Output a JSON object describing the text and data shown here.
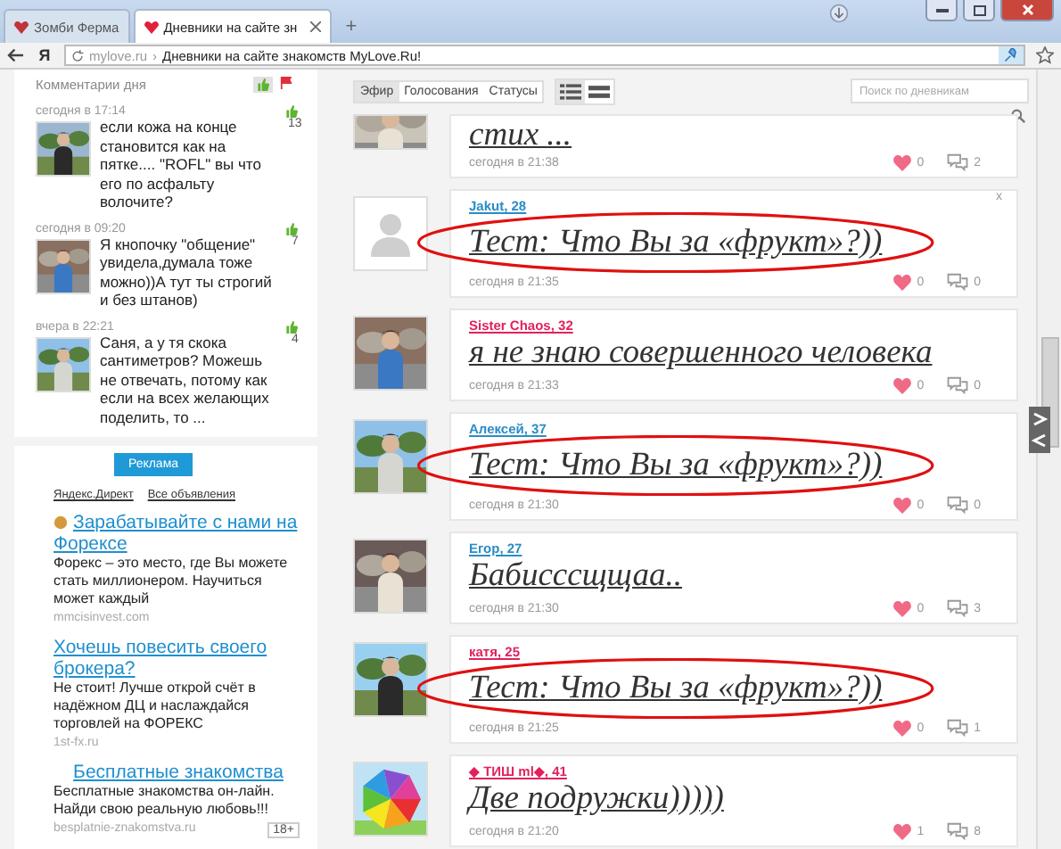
{
  "browser": {
    "tabs": [
      {
        "title": "Зомби Ферма",
        "selected": false
      },
      {
        "title": "Дневники на сайте зн",
        "selected": true
      }
    ],
    "new_tab": "+",
    "logo": "Я",
    "address": {
      "domain": "mylove.ru",
      "separator": "›",
      "title": "Дневники на сайте знакомств MyLove.Ru!"
    }
  },
  "sidebar": {
    "header": "Комментарии дня",
    "comments": [
      {
        "time": "сегодня в 17:14",
        "text": "если кожа на конце становится как на пятке.... \"ROFL\" вы что его по асфальту волочите?",
        "likes": "13"
      },
      {
        "time": "сегодня в 09:20",
        "text": "Я кнопочку \"общение\" увидела,думала тоже можно))А тут ты строгий и без штанов)",
        "likes": "7"
      },
      {
        "time": "вчера в 22:21",
        "text": "Саня, а у тя скока сантиметров? Можешь не отвечать, потому как если на всех желающих поделить, то ...",
        "likes": "4"
      }
    ],
    "ads": {
      "button": "Реклама",
      "links": [
        "Яндекс.Директ",
        "Все объявления"
      ],
      "items": [
        {
          "title": "Зарабатывайте с нами на Форексе",
          "text": "Форекс – это место, где Вы можете стать миллионером. Научиться может каждый",
          "domain": "mmcisinvest.com",
          "kind": "inline"
        },
        {
          "title": "Хочешь повесить своего брокера?",
          "text": "Не стоит! Лучше открой счёт в надёжном ДЦ и наслаждайся торговлей на ФОРЕКС",
          "domain": "1st-fx.ru",
          "kind": "inline"
        },
        {
          "title": "Бесплатные знакомства",
          "text": "Бесплатные знакомства он-лайн. Найди свою реальную любовь!!!",
          "domain": "besplatnie-znakomstva.ru",
          "kind": "centered"
        }
      ],
      "age": "18+"
    }
  },
  "feed": {
    "tabs": [
      {
        "label": "Эфир",
        "selected": true
      },
      {
        "label": "Голосования",
        "selected": false
      },
      {
        "label": "Статусы",
        "selected": false
      }
    ],
    "view_modes": [
      {
        "selected": true
      },
      {
        "selected": false
      }
    ],
    "search": {
      "placeholder": "Поиск по дневникам"
    },
    "posts": [
      {
        "title": "стих ...",
        "time": "сегодня в 21:38",
        "likes": "0",
        "comments": "2",
        "highlighted": false
      },
      {
        "author": "Jakut, 28",
        "color": "#2a8dc5",
        "title": "Тест: Что Вы за «фрукт»?))",
        "time": "сегодня в 21:35",
        "likes": "0",
        "comments": "0",
        "avatar": {
          "kind": "placeholder"
        },
        "highlighted": true,
        "dismiss": "x"
      },
      {
        "author": "Sister Chaos, 32",
        "color": "#e2215b",
        "title": "я не знаю совершенного человека",
        "time": "сегодня в 21:33",
        "likes": "0",
        "comments": "0",
        "highlighted": false
      },
      {
        "author": "Алексей, 37",
        "color": "#2a8dc5",
        "title": "Тест: Что Вы за «фрукт»?))",
        "time": "сегодня в 21:30",
        "likes": "0",
        "comments": "0",
        "highlighted": true
      },
      {
        "author": "Егор, 27",
        "color": "#2a8dc5",
        "title": "Бабисссщщаа..",
        "time": "сегодня в 21:30",
        "likes": "0",
        "comments": "3",
        "highlighted": false
      },
      {
        "author": "катя, 25",
        "color": "#e2215b",
        "title": "Тест: Что Вы за «фрукт»?))",
        "time": "сегодня в 21:25",
        "likes": "0",
        "comments": "1",
        "highlighted": true
      },
      {
        "author": "◆ ТИШ ml◆, 41",
        "color": "#e2215b",
        "title": "Две подружки)))))",
        "time": "сегодня в 21:20",
        "likes": "1",
        "comments": "8",
        "highlighted": false
      }
    ]
  }
}
